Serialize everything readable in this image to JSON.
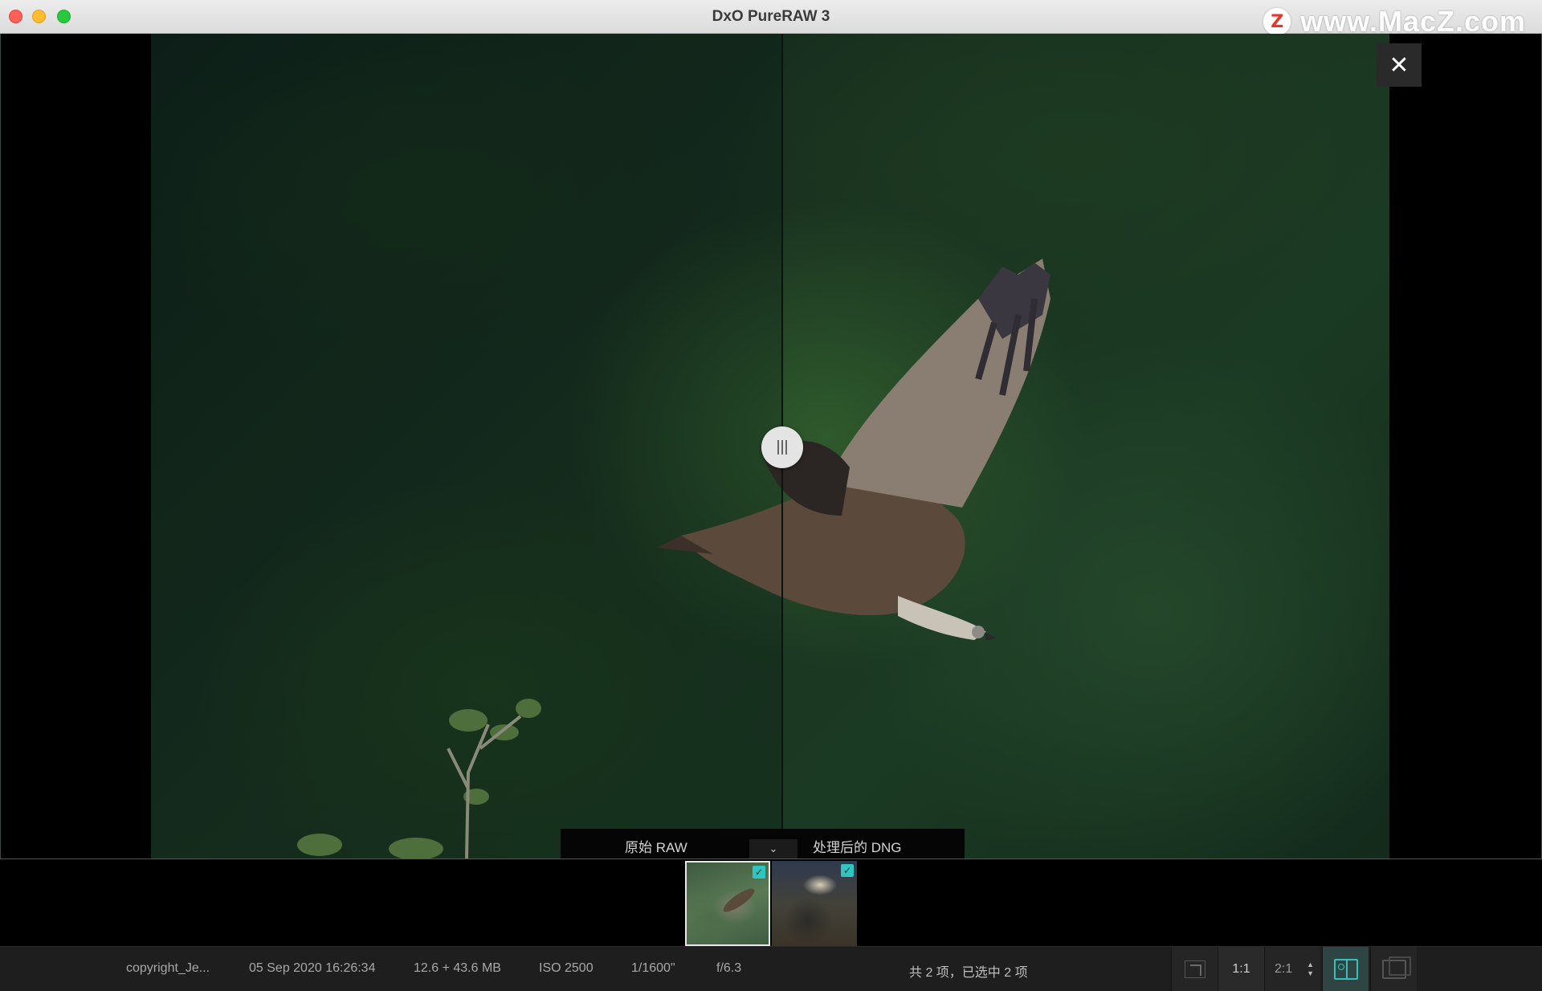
{
  "window": {
    "title": "DxO PureRAW 3",
    "watermark": "www.MacZ.com",
    "watermark_logo": "Z"
  },
  "viewer": {
    "close_label": "✕",
    "compare": {
      "left_label": "原始 RAW",
      "right_label": "处理后的 DNG",
      "collapse_glyph": "⌄"
    },
    "split_handle_glyph": "|||"
  },
  "filmstrip": {
    "items": [
      {
        "name": "vulture-photo",
        "checked": true,
        "selected": true
      },
      {
        "name": "interior-photo",
        "checked": true,
        "selected": false
      }
    ],
    "check_glyph": "✓"
  },
  "statusbar": {
    "filename": "copyright_Je...",
    "date": "05 Sep 2020 16:26:34",
    "size": "12.6 + 43.6 MB",
    "iso": "ISO 2500",
    "shutter": "1/1600\"",
    "aperture": "f/6.3",
    "selection_count": "共 2 项，已选中 2 项",
    "zoom_1_1": "1:1",
    "zoom_2_1": "2:1",
    "stepper_up": "▲",
    "stepper_down": "▼"
  },
  "colors": {
    "accent": "#37c0bc",
    "checkbox": "#30c5c0",
    "close_traffic": "#fe5f57",
    "min_traffic": "#febc2e",
    "max_traffic": "#28c840"
  }
}
